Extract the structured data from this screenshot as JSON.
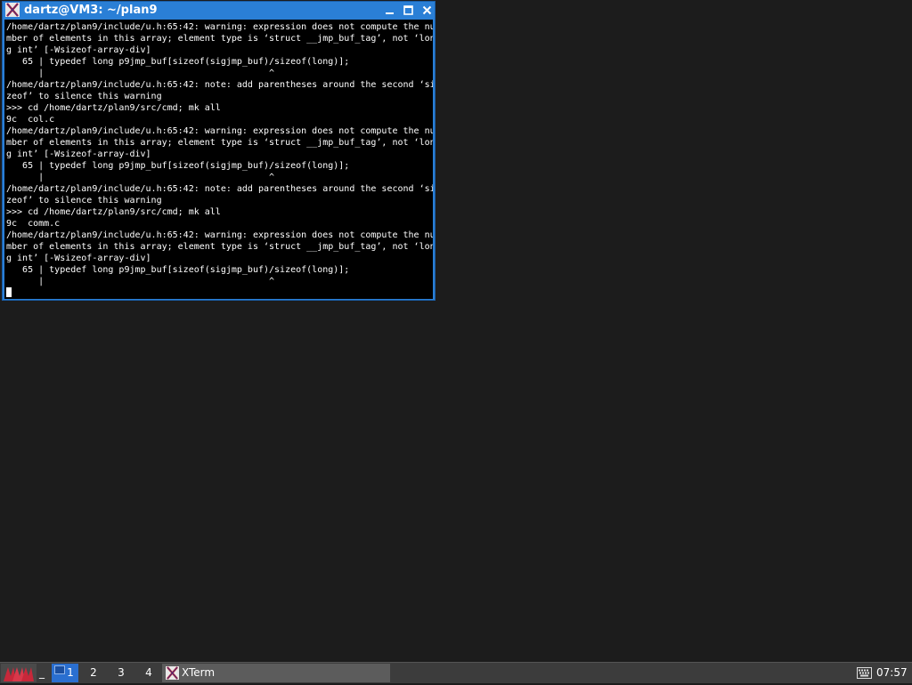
{
  "window": {
    "title": "dartz@VM3: ~/plan9",
    "title_color": "#2a7fd6"
  },
  "terminal": {
    "lines": [
      "/home/dartz/plan9/include/u.h:65:42: warning: expression does not compute the nu",
      "mber of elements in this array; element type is ‘struct __jmp_buf_tag’, not ‘lon",
      "g int’ [-Wsizeof-array-div]",
      "   65 | typedef long p9jmp_buf[sizeof(sigjmp_buf)/sizeof(long)];",
      "      |                                          ^",
      "/home/dartz/plan9/include/u.h:65:42: note: add parentheses around the second ‘si",
      "zeof’ to silence this warning",
      ">>> cd /home/dartz/plan9/src/cmd; mk all",
      "9c  col.c",
      "/home/dartz/plan9/include/u.h:65:42: warning: expression does not compute the nu",
      "mber of elements in this array; element type is ‘struct __jmp_buf_tag’, not ‘lon",
      "g int’ [-Wsizeof-array-div]",
      "   65 | typedef long p9jmp_buf[sizeof(sigjmp_buf)/sizeof(long)];",
      "      |                                          ^",
      "/home/dartz/plan9/include/u.h:65:42: note: add parentheses around the second ‘si",
      "zeof’ to silence this warning",
      ">>> cd /home/dartz/plan9/src/cmd; mk all",
      "9c  comm.c",
      "/home/dartz/plan9/include/u.h:65:42: warning: expression does not compute the nu",
      "mber of elements in this array; element type is ‘struct __jmp_buf_tag’, not ‘lon",
      "g int’ [-Wsizeof-array-div]",
      "   65 | typedef long p9jmp_buf[sizeof(sigjmp_buf)/sizeof(long)];",
      "      |                                          ^"
    ]
  },
  "taskbar": {
    "show_desktop_label": "_",
    "desktops": [
      "1",
      "2",
      "3",
      "4"
    ],
    "active_desktop": "1",
    "task_label": "XTerm",
    "clock": "07:57",
    "active_color": "#2a6fd0"
  },
  "icons": {
    "window": "xterm-icon",
    "start": "start-menu-icon",
    "tray": "keyboard-icon"
  }
}
